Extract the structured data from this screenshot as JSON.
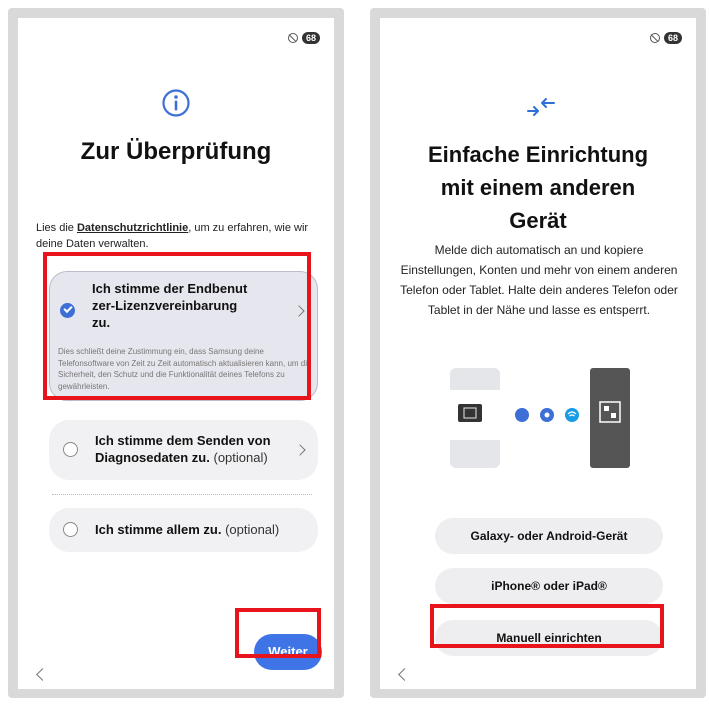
{
  "left_screen": {
    "status": {
      "battery": "68",
      "dnd_icon": "do-not-disturb-icon"
    },
    "title": "Zur Überprüfung",
    "intro": {
      "before": "Lies die ",
      "link": "Datenschutzrichtlinie",
      "after": ", um zu erfahren, wie wir deine Daten verwalten."
    },
    "eula": {
      "label_line1": "Ich stimme der Endbenut",
      "label_line2": "zer-Lizenzvereinbarung",
      "label_line3": "zu.",
      "checked": true,
      "description": "Dies schließt deine Zustimmung ein, dass Samsung deine Telefonsoftware von Zeit zu Zeit automatisch aktualisieren kann, um die Sicherheit, den Schutz und die Funktionalität deines Telefons zu gewährleisten."
    },
    "diagnostics": {
      "label_line1": "Ich stimme dem Senden von",
      "label_line2": "Diagnosedaten zu.",
      "optional": "(optional)",
      "checked": false
    },
    "accept_all": {
      "label": "Ich stimme allem zu.",
      "optional": "(optional)",
      "checked": false
    },
    "next_button": "Weiter"
  },
  "right_screen": {
    "status": {
      "battery": "68",
      "dnd_icon": "do-not-disturb-icon"
    },
    "title_line1": "Einfache Einrichtung",
    "title_line2": "mit einem anderen",
    "title_line3": "Gerät",
    "description": "Melde dich automatisch an und kopiere Einstellungen, Konten und mehr von einem anderen Telefon oder Tablet. Halte dein anderes Telefon oder Tablet in der Nähe und lasse es entsperrt.",
    "buttons": {
      "galaxy": "Galaxy- oder Android-Gerät",
      "iphone": "iPhone® oder iPad®",
      "manual": "Manuell einrichten"
    }
  },
  "colors": {
    "accent": "#3e74e6",
    "highlight": "#e8141c"
  }
}
